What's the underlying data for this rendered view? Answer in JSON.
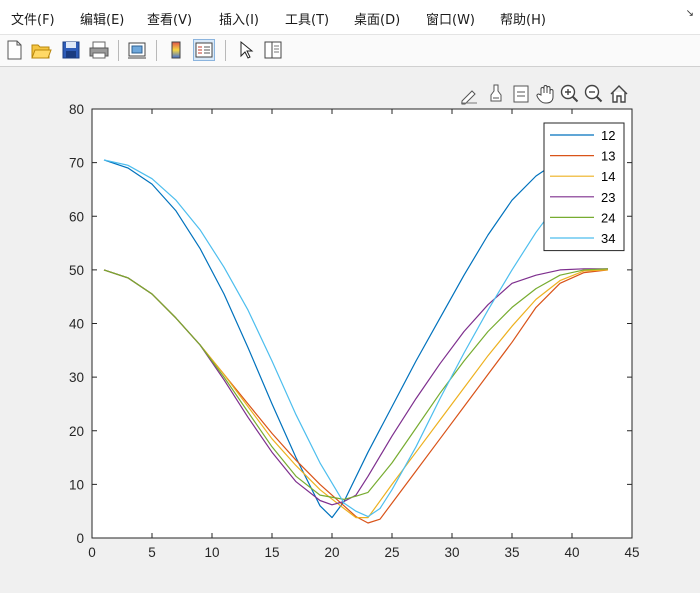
{
  "menu": {
    "items": [
      {
        "label": "文件(F)"
      },
      {
        "label": "编辑(E)"
      },
      {
        "label": "查看(V)"
      },
      {
        "label": "插入(I)"
      },
      {
        "label": "工具(T)"
      },
      {
        "label": "桌面(D)"
      },
      {
        "label": "窗口(W)"
      },
      {
        "label": "帮助(H)"
      }
    ]
  },
  "toolbar": {
    "buttons": [
      "new-file-icon",
      "open-folder-icon",
      "save-icon",
      "print-icon",
      "link-plot-icon",
      "colorbar-icon",
      "legend-icon",
      "edit-plot-arrow-icon",
      "property-inspector-icon"
    ]
  },
  "axes_toolbar": {
    "buttons": [
      "brush-data-icon",
      "data-tips-icon",
      "export-icon",
      "pan-icon",
      "zoom-in-icon",
      "zoom-out-icon",
      "restore-view-icon"
    ]
  },
  "chart_data": {
    "type": "line",
    "title": "",
    "xlabel": "",
    "ylabel": "",
    "xlim": [
      0,
      45
    ],
    "ylim": [
      0,
      80
    ],
    "xticks": [
      "0",
      "5",
      "10",
      "15",
      "20",
      "25",
      "30",
      "35",
      "40",
      "45"
    ],
    "yticks": [
      "0",
      "10",
      "20",
      "30",
      "40",
      "50",
      "60",
      "70",
      "80"
    ],
    "grid": false,
    "legend_position": "top-right",
    "series": [
      {
        "name": "12",
        "color": "#0072BD",
        "x": [
          1,
          3,
          5,
          7,
          9,
          11,
          13,
          15,
          17,
          19,
          20,
          21,
          23,
          25,
          27,
          29,
          31,
          33,
          35,
          37,
          39,
          41,
          43
        ],
        "y": [
          70.5,
          69,
          66,
          61,
          54,
          45.5,
          35.5,
          25,
          15,
          6,
          3.8,
          6.8,
          16,
          24.5,
          33,
          41,
          49,
          56.5,
          63,
          67.5,
          70.5,
          72,
          72.3
        ]
      },
      {
        "name": "13",
        "color": "#D95319",
        "x": [
          1,
          3,
          5,
          7,
          9,
          11,
          13,
          15,
          17,
          19,
          21,
          22,
          23,
          24,
          25,
          27,
          29,
          31,
          33,
          35,
          37,
          39,
          41,
          43
        ],
        "y": [
          50,
          48.5,
          45.5,
          41,
          36,
          30.5,
          25,
          19.5,
          14.5,
          10,
          6,
          4,
          2.8,
          3.5,
          6.5,
          12.5,
          18.5,
          24.5,
          30.5,
          36.5,
          43,
          47.5,
          49.5,
          50
        ]
      },
      {
        "name": "14",
        "color": "#EDB120",
        "x": [
          1,
          3,
          5,
          7,
          9,
          11,
          13,
          15,
          17,
          19,
          21,
          22,
          23,
          25,
          27,
          29,
          31,
          33,
          35,
          37,
          39,
          41,
          43
        ],
        "y": [
          50,
          48.5,
          45.5,
          41,
          36,
          30.5,
          24.5,
          18.5,
          13.5,
          9,
          5.5,
          3.8,
          3.8,
          10,
          16,
          22,
          28,
          34,
          39.5,
          44.5,
          48,
          49.8,
          50
        ]
      },
      {
        "name": "23",
        "color": "#7E2F8E",
        "x": [
          1,
          3,
          5,
          7,
          9,
          11,
          13,
          15,
          17,
          19,
          20,
          21,
          22,
          23,
          25,
          27,
          29,
          31,
          33,
          35,
          37,
          39,
          41,
          43
        ],
        "y": [
          50,
          48.5,
          45.5,
          41,
          36,
          29.5,
          22.5,
          16,
          10.5,
          7,
          6.2,
          6.8,
          8,
          11.5,
          19,
          26,
          32.5,
          38.5,
          43.5,
          47.5,
          49,
          50,
          50.2,
          50.2
        ]
      },
      {
        "name": "24",
        "color": "#77AC30",
        "x": [
          1,
          3,
          5,
          7,
          9,
          11,
          13,
          15,
          17,
          19,
          21,
          22,
          23,
          25,
          27,
          29,
          31,
          33,
          35,
          37,
          39,
          41,
          43
        ],
        "y": [
          50,
          48.5,
          45.5,
          41,
          36,
          30,
          23.5,
          17,
          11.5,
          8,
          7.2,
          7.8,
          8.5,
          14,
          20.5,
          27,
          33,
          38.5,
          43,
          46.5,
          49,
          50,
          50.2
        ]
      },
      {
        "name": "34",
        "color": "#4DBEEE",
        "x": [
          1,
          3,
          5,
          7,
          9,
          11,
          13,
          15,
          17,
          19,
          21,
          22,
          23,
          24,
          25,
          27,
          29,
          31,
          33,
          35,
          37,
          39,
          41,
          43
        ],
        "y": [
          70.5,
          69.5,
          67,
          63,
          57.5,
          50.5,
          42.5,
          33,
          23,
          14,
          6.5,
          5,
          4,
          5.5,
          9,
          17,
          26,
          34.5,
          42.5,
          50,
          57,
          63,
          68,
          70.5
        ]
      }
    ]
  }
}
